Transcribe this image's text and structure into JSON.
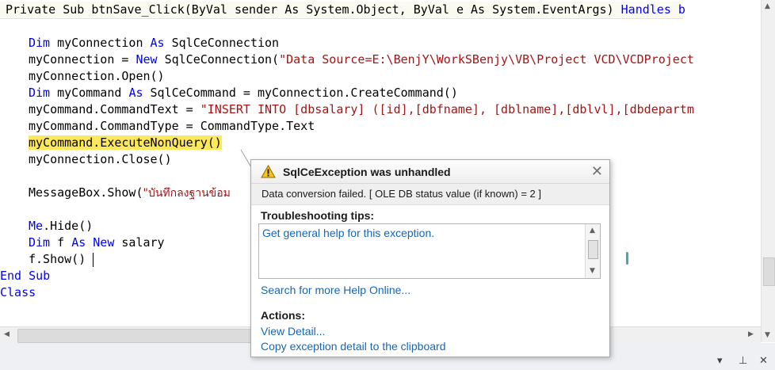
{
  "code": {
    "line0": [
      "Private Sub btnSave_Click(ByVal sender As System.Object, ByVal e As System.EventArgs) ",
      "Handles b"
    ],
    "line1": [
      "Dim ",
      "myConnection ",
      "As ",
      "SqlCeConnection"
    ],
    "line2": [
      "myConnection = ",
      "New ",
      "SqlCeConnection(",
      "\"Data Source=E:\\BenjY\\WorkSBenjy\\VB\\Project VCD\\VCDProject"
    ],
    "line3": "myConnection.Open()",
    "line4": [
      "Dim ",
      "myCommand ",
      "As ",
      "SqlCeCommand = myConnection.CreateCommand()"
    ],
    "line5": [
      "myCommand.CommandText = ",
      "\"INSERT INTO [dbsalary] ([id],[dbfname], [dblname],[dblvl],[dbdepartm"
    ],
    "line6": "myCommand.CommandType = CommandType.Text",
    "line7": "myCommand.ExecuteNonQuery()",
    "line8": "myConnection.Close()",
    "line10": [
      "MessageBox.Show(",
      "\"บันทึกลงฐานข้อม"
    ],
    "line12": [
      "Me",
      ".Hide()"
    ],
    "line13": [
      "Dim ",
      "f ",
      "As ",
      "New ",
      "salary"
    ],
    "line14": "f.Show()",
    "line15": "End Sub",
    "line16": "Class"
  },
  "exception": {
    "title": "SqlCeException was unhandled",
    "message": "Data conversion failed. [ OLE DB status value (if known) = 2 ]",
    "tips_heading": "Troubleshooting tips:",
    "tip_link": "Get general help for this exception.",
    "search_link": "Search for more Help Online...",
    "actions_heading": "Actions:",
    "view_detail": "View Detail...",
    "copy_detail": "Copy exception detail to the clipboard",
    "close_glyph": "✕",
    "warning_icon": "warning-triangle-icon"
  },
  "bottom_icons": [
    "▾",
    "⊥",
    "✕"
  ],
  "colors": {
    "keyword": "#0000ff",
    "string": "#a31515",
    "highlight": "#fce85c",
    "link": "#1666b8"
  }
}
